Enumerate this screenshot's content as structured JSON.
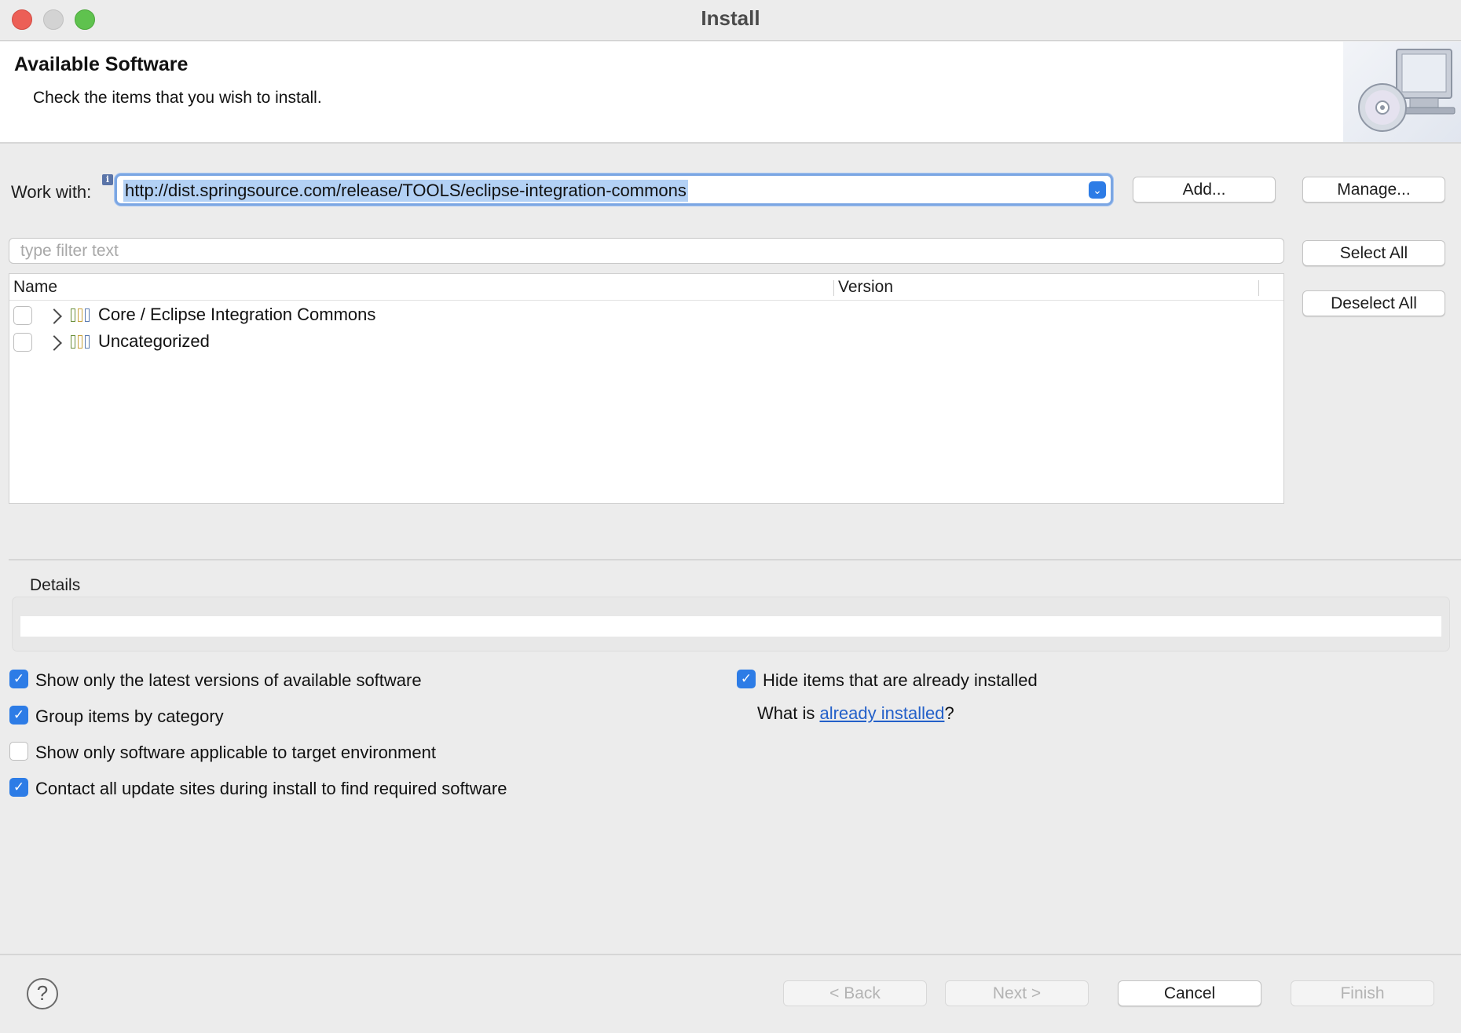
{
  "window": {
    "title": "Install"
  },
  "banner": {
    "title": "Available Software",
    "description": "Check the items that you wish to install."
  },
  "work_with": {
    "label": "Work with:",
    "info_icon": "info-icon",
    "value": "http://dist.springsource.com/release/TOOLS/eclipse-integration-commons",
    "dropdown_icon": "chevron-down-icon"
  },
  "buttons": {
    "add": "Add...",
    "manage": "Manage...",
    "select_all": "Select All",
    "deselect_all": "Deselect All"
  },
  "filter": {
    "placeholder": "type filter text",
    "value": ""
  },
  "tree": {
    "columns": [
      "Name",
      "Version"
    ],
    "rows": [
      {
        "label": "Core / Eclipse Integration Commons",
        "version": "",
        "checked": false,
        "expanded": false
      },
      {
        "label": "Uncategorized",
        "version": "",
        "checked": false,
        "expanded": false
      }
    ]
  },
  "details": {
    "label": "Details",
    "text": ""
  },
  "options": {
    "latest_versions": {
      "label": "Show only the latest versions of available software",
      "checked": true
    },
    "group_by_category": {
      "label": "Group items by category",
      "checked": true
    },
    "target_environment": {
      "label": "Show only software applicable to target environment",
      "checked": false
    },
    "contact_update_sites": {
      "label": "Contact all update sites during install to find required software",
      "checked": true
    },
    "hide_installed": {
      "label": "Hide items that are already installed",
      "checked": true
    }
  },
  "what_is": {
    "prefix": "What is ",
    "link": "already installed",
    "suffix": "?"
  },
  "footer": {
    "help_icon": "help-icon",
    "back": "< Back",
    "next": "Next >",
    "cancel": "Cancel",
    "finish": "Finish"
  },
  "colors": {
    "accent": "#2d7ce6",
    "selection": "#b3d1f5",
    "link": "#2360c9"
  }
}
